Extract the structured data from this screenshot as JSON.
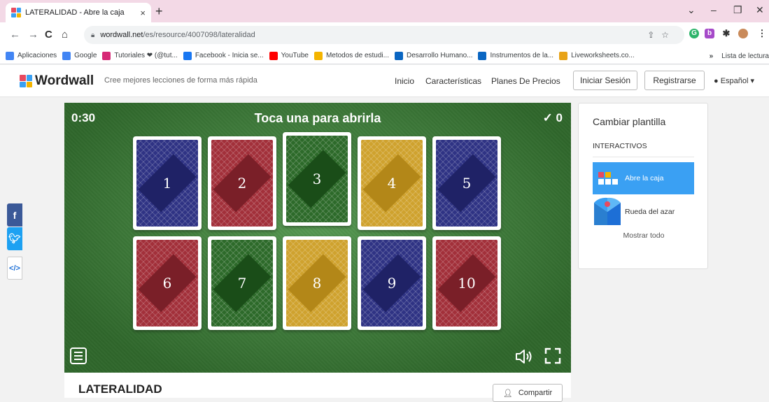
{
  "browser": {
    "tab_title": "LATERALIDAD - Abre la caja",
    "tab_close": "×",
    "new_tab": "+",
    "url_host": "wordwall.net",
    "url_path": "/es/resource/4007098/lateralidad",
    "bookmarks": [
      {
        "label": "Aplicaciones",
        "icon": "apps-grid-icon",
        "color": "#4285f4"
      },
      {
        "label": "Google",
        "icon": "google-icon",
        "color": "#4285f4"
      },
      {
        "label": "Tutoriales ❤ (@tut...",
        "icon": "instagram-icon",
        "color": "#d62976"
      },
      {
        "label": "Facebook - Inicia se...",
        "icon": "facebook-icon",
        "color": "#1877f2"
      },
      {
        "label": "YouTube",
        "icon": "youtube-icon",
        "color": "#ff0000"
      },
      {
        "label": "Metodos de estudi...",
        "icon": "doc-icon",
        "color": "#f4b400"
      },
      {
        "label": "Desarrollo Humano...",
        "icon": "linkedin-icon",
        "color": "#0a66c2"
      },
      {
        "label": "Instrumentos de la...",
        "icon": "linkedin-icon",
        "color": "#0a66c2"
      },
      {
        "label": "Liveworksheets.co...",
        "icon": "liveworksheets-icon",
        "color": "#e8a317"
      }
    ],
    "bookmarks_overflow": "»",
    "reading_list": "Lista de lectura"
  },
  "site": {
    "logo": "Wordwall",
    "tagline": "Cree mejores lecciones de forma más rápida",
    "nav": [
      "Inicio",
      "Características",
      "Planes De Precios"
    ],
    "login": "Iniciar Sesión",
    "register": "Registrarse",
    "language": "Español ▾"
  },
  "game": {
    "timer": "0:30",
    "prompt": "Toca una para abrirla",
    "score": "✓ 0",
    "cards": [
      {
        "label": "1",
        "color": "#2f3384",
        "diamond": "#1f2266"
      },
      {
        "label": "2",
        "color": "#a2303a",
        "diamond": "#7a1f28"
      },
      {
        "label": "3",
        "color": "#2d6a2a",
        "diamond": "#1a4d18"
      },
      {
        "label": "4",
        "color": "#cfa22e",
        "diamond": "#b38718"
      },
      {
        "label": "5",
        "color": "#2f3384",
        "diamond": "#1f2266"
      },
      {
        "label": "6",
        "color": "#a2303a",
        "diamond": "#7a1f28"
      },
      {
        "label": "7",
        "color": "#2d6a2a",
        "diamond": "#1a4d18"
      },
      {
        "label": "8",
        "color": "#cfa22e",
        "diamond": "#b38718"
      },
      {
        "label": "9",
        "color": "#2f3384",
        "diamond": "#1f2266"
      },
      {
        "label": "10",
        "color": "#a2303a",
        "diamond": "#7a1f28"
      }
    ]
  },
  "panel": {
    "title": "Cambiar plantilla",
    "section": "INTERACTIVOS",
    "templates": [
      {
        "label": "Abre la caja",
        "active": true
      },
      {
        "label": "Rueda del azar",
        "active": false
      }
    ],
    "show_all": "Mostrar todo"
  },
  "activity": {
    "title": "LATERALIDAD",
    "share": "Compartir"
  }
}
